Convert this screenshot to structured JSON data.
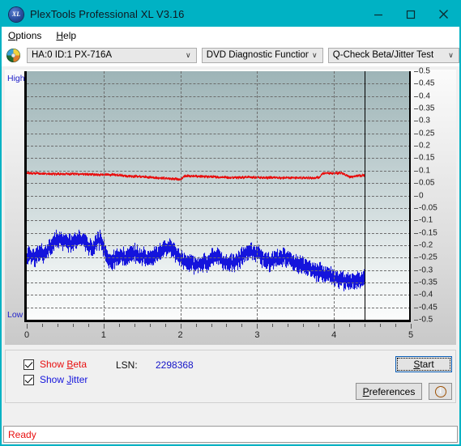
{
  "window": {
    "title": "PlexTools Professional XL V3.16",
    "icon": "XL",
    "minimize": "minimize-icon",
    "maximize": "maximize-icon",
    "close": "close-icon"
  },
  "menubar": {
    "items": [
      {
        "label": "Options",
        "accel": "O"
      },
      {
        "label": "Help",
        "accel": "H"
      }
    ]
  },
  "toolbar": {
    "disc_icon": "disc-icon",
    "drive_combo": {
      "value": "HA:0 ID:1  PX-716A",
      "arrow": "∨"
    },
    "function_combo": {
      "value": "DVD Diagnostic Functions",
      "arrow": "∨"
    },
    "test_combo": {
      "value": "Q-Check Beta/Jitter Test",
      "arrow": "∨"
    }
  },
  "chart_data": {
    "type": "line",
    "title": "Q-Check Beta/Jitter Test",
    "xlabel": "",
    "ylabel": "",
    "xlim": [
      0,
      5
    ],
    "ylim": [
      -0.5,
      0.5
    ],
    "xticks": [
      0,
      1,
      2,
      3,
      4,
      5
    ],
    "yticks": [
      0.5,
      0.45,
      0.4,
      0.35,
      0.3,
      0.25,
      0.2,
      0.15,
      0.1,
      0.05,
      0,
      -0.05,
      -0.1,
      -0.15,
      -0.2,
      -0.25,
      -0.3,
      -0.35,
      -0.4,
      -0.45,
      -0.5
    ],
    "ytick_labels": [
      "0.5",
      "0.45",
      "0.4",
      "0.35",
      "0.3",
      "0.25",
      "0.2",
      "0.15",
      "0.1",
      "0.05",
      "0",
      "-0.05",
      "-0.1",
      "-0.15",
      "-0.2",
      "-0.25",
      "-0.3",
      "-0.35",
      "-0.4",
      "-0.45",
      "-0.5"
    ],
    "xtick_labels": [
      "0",
      "1",
      "2",
      "3",
      "4",
      "5"
    ],
    "grid": true,
    "axis_high_label": "High",
    "axis_low_label": "Low",
    "cursor_x": 4.4,
    "data_end_x": 4.4,
    "legend_position": "bottom-left",
    "series": [
      {
        "name": "Show Beta",
        "color": "#e81010",
        "x": [
          0.0,
          0.1,
          0.2,
          0.3,
          0.4,
          0.5,
          0.6,
          0.7,
          0.8,
          0.9,
          1.0,
          1.1,
          1.2,
          1.3,
          1.4,
          1.5,
          1.6,
          1.7,
          1.8,
          1.9,
          2.0,
          2.05,
          2.1,
          2.2,
          2.3,
          2.4,
          2.5,
          2.6,
          2.7,
          2.8,
          2.9,
          3.0,
          3.1,
          3.2,
          3.3,
          3.4,
          3.5,
          3.6,
          3.7,
          3.8,
          3.85,
          3.9,
          4.0,
          4.1,
          4.2,
          4.25,
          4.3,
          4.4
        ],
        "y": [
          0.09,
          0.089,
          0.088,
          0.087,
          0.086,
          0.086,
          0.087,
          0.086,
          0.085,
          0.084,
          0.084,
          0.083,
          0.081,
          0.079,
          0.077,
          0.075,
          0.073,
          0.071,
          0.069,
          0.067,
          0.065,
          0.077,
          0.078,
          0.077,
          0.076,
          0.075,
          0.074,
          0.073,
          0.073,
          0.073,
          0.073,
          0.072,
          0.072,
          0.072,
          0.071,
          0.071,
          0.071,
          0.071,
          0.071,
          0.072,
          0.088,
          0.09,
          0.09,
          0.09,
          0.074,
          0.076,
          0.08,
          0.081
        ],
        "noise": 0.006
      },
      {
        "name": "Show Jitter",
        "color": "#1414dc",
        "x": [
          0.0,
          0.05,
          0.1,
          0.15,
          0.2,
          0.25,
          0.3,
          0.35,
          0.4,
          0.45,
          0.5,
          0.55,
          0.6,
          0.65,
          0.7,
          0.75,
          0.8,
          0.85,
          0.9,
          0.95,
          1.0,
          1.05,
          1.1,
          1.15,
          1.2,
          1.25,
          1.3,
          1.35,
          1.4,
          1.45,
          1.5,
          1.55,
          1.6,
          1.65,
          1.7,
          1.75,
          1.8,
          1.85,
          1.9,
          1.95,
          2.0,
          2.05,
          2.1,
          2.15,
          2.2,
          2.25,
          2.3,
          2.35,
          2.4,
          2.45,
          2.5,
          2.55,
          2.6,
          2.65,
          2.7,
          2.75,
          2.8,
          2.85,
          2.9,
          2.95,
          3.0,
          3.05,
          3.1,
          3.15,
          3.2,
          3.25,
          3.3,
          3.35,
          3.4,
          3.45,
          3.5,
          3.55,
          3.6,
          3.65,
          3.7,
          3.75,
          3.8,
          3.85,
          3.9,
          3.95,
          4.0,
          4.05,
          4.1,
          4.15,
          4.2,
          4.25,
          4.3,
          4.35,
          4.4
        ],
        "y": [
          -0.245,
          -0.235,
          -0.25,
          -0.24,
          -0.235,
          -0.225,
          -0.205,
          -0.185,
          -0.175,
          -0.18,
          -0.185,
          -0.195,
          -0.185,
          -0.175,
          -0.178,
          -0.18,
          -0.205,
          -0.215,
          -0.185,
          -0.18,
          -0.215,
          -0.25,
          -0.26,
          -0.255,
          -0.25,
          -0.245,
          -0.248,
          -0.235,
          -0.23,
          -0.24,
          -0.245,
          -0.25,
          -0.25,
          -0.245,
          -0.235,
          -0.225,
          -0.21,
          -0.205,
          -0.215,
          -0.235,
          -0.255,
          -0.268,
          -0.272,
          -0.275,
          -0.275,
          -0.272,
          -0.27,
          -0.268,
          -0.255,
          -0.24,
          -0.25,
          -0.265,
          -0.268,
          -0.27,
          -0.268,
          -0.26,
          -0.245,
          -0.23,
          -0.225,
          -0.228,
          -0.235,
          -0.25,
          -0.258,
          -0.265,
          -0.262,
          -0.258,
          -0.252,
          -0.248,
          -0.252,
          -0.262,
          -0.268,
          -0.275,
          -0.285,
          -0.292,
          -0.298,
          -0.302,
          -0.308,
          -0.312,
          -0.318,
          -0.325,
          -0.332,
          -0.34,
          -0.345,
          -0.348,
          -0.345,
          -0.34,
          -0.338,
          -0.335,
          -0.332
        ],
        "noise": 0.035
      }
    ]
  },
  "controls": {
    "show_beta": {
      "label": "Show Beta",
      "accel": "B",
      "checked": true
    },
    "show_jitter": {
      "label": "Show Jitter",
      "accel": "J",
      "checked": true
    },
    "lsn_label": "LSN:",
    "lsn_value": "2298368",
    "start_button": {
      "label": "Start",
      "accel": "S"
    },
    "preferences_button": {
      "label": "Preferences",
      "accel": "P"
    },
    "info_button": {
      "label": "i",
      "icon": "info-icon"
    }
  },
  "statusbar": {
    "text": "Ready"
  }
}
